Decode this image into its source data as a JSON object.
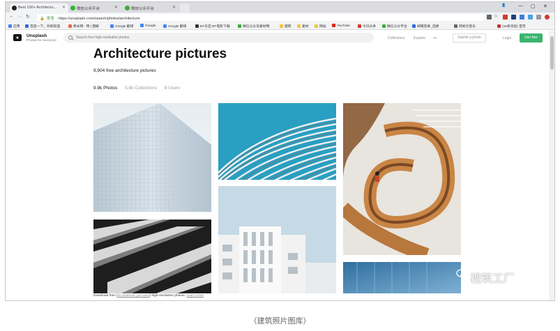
{
  "browser": {
    "tabs": [
      {
        "title": "Best 100+ Architectu...",
        "favicon_color": "#222222",
        "active": true
      },
      {
        "title": "微信公众平台",
        "favicon_color": "#3cb034",
        "active": false
      },
      {
        "title": "微信公众平台",
        "favicon_color": "#3cb034",
        "active": false
      }
    ],
    "url": "https://unsplash.com/search/photos/architecture",
    "secure_label": "安全",
    "window_controls": [
      "—",
      "▢",
      "✕"
    ],
    "bookmarks": [
      {
        "label": "应用",
        "color": "#4285f4"
      },
      {
        "label": "百度一下，你就知道",
        "color": "#2f6bd9"
      },
      {
        "label": "秀米网 - 用 | 图解",
        "color": "#e36b4a"
      },
      {
        "label": "Google 翻译",
        "color": "#4285f4"
      },
      {
        "label": "Google",
        "color": "#4285f4"
      },
      {
        "label": "Google 翻译",
        "color": "#4285f4"
      },
      {
        "label": "BT天堂-BT电影下载",
        "color": "#333333"
      },
      {
        "label": "微信公众号素材网",
        "color": "#3cb034"
      },
      {
        "label": "建筑",
        "color": "#f4c542"
      },
      {
        "label": "素材",
        "color": "#f4c542"
      },
      {
        "label": "网站",
        "color": "#f4c542"
      },
      {
        "label": "YouTube",
        "color": "#e62117"
      },
      {
        "label": "今日头条",
        "color": "#d4352a"
      },
      {
        "label": "微信公众平台",
        "color": "#3cb034"
      },
      {
        "label": "邮箱登录_迅捷",
        "color": "#2f6bd9"
      },
      {
        "label": "网易云音乐",
        "color": "#666666"
      },
      {
        "label": "(16条消息) 首页",
        "color": "#c0392b"
      }
    ]
  },
  "header": {
    "brand": "Unsplash",
    "tagline": "Photos for everyone",
    "search_placeholder": "Search free high-resolution photos",
    "nav": {
      "collections": "Collections",
      "explore": "Explore",
      "more": "•••"
    },
    "submit_label": "Submit a photo",
    "login_label": "Login",
    "join_label": "Join free",
    "accent_color": "#3cb46e"
  },
  "main": {
    "title": "Architecture pictures",
    "subtitle": "9,904 free architecture pictures",
    "filters": [
      {
        "label": "9.9k Photos",
        "active": true
      },
      {
        "label": "5.8k Collections",
        "active": false
      },
      {
        "label": "8 Users",
        "active": false
      }
    ]
  },
  "footer": {
    "prefix": "Download free",
    "link_text": "do whatever you want",
    "suffix": "high-resolution photos.",
    "learn_more": "Learn more"
  },
  "watermark": "视筑工厂",
  "caption": "（建筑照片图库）"
}
